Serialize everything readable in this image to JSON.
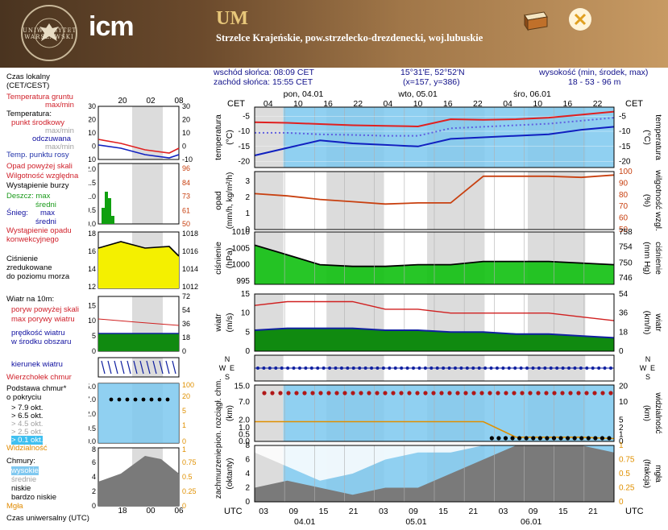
{
  "header": {
    "uw_logo_text": "UNIWERSYTET WARSZAWSKI",
    "icm_logo": "icm",
    "model": "UM",
    "location": "Strzelce Krajeńskie, pow.strzelecko-drezdenecki, woj.lubuskie",
    "archive_icon": "archive-box-icon",
    "close_icon": "close-x-icon"
  },
  "info": {
    "sunrise": "wschód słońca: 08:09 CET",
    "sunset": "zachód słońca: 15:55 CET",
    "coords": "15°31'E, 52°52'N",
    "grid": "(x=157, y=386)",
    "elev_label": "wysokość (min, środek, max)",
    "elev_values": "18 - 53 - 96 m"
  },
  "legend": {
    "local_time": "Czas lokalny",
    "local_time2": "(CET/CEST)",
    "soil_temp": "Temperatura gruntu",
    "soil_temp2": "max/min",
    "temperature": "Temperatura:",
    "center_point": "punkt środkowy",
    "maxmin": "max/min",
    "perceived": "odczuwana",
    "dew_point": "Temp. punktu rosy",
    "precip_over": "Opad powyżej skali",
    "humidity": "Wilgotność względna",
    "storm": "Wystąpienie burzy",
    "rain": "Deszcz: max",
    "rain_avg": "średni",
    "snow": "Śnieg:",
    "snow_max": "max",
    "snow_avg": "średni",
    "convective": "Wystąpienie opadu",
    "convective2": "konwekcyjnego",
    "pressure": "Ciśnienie",
    "pressure2": "zredukowane",
    "pressure3": "do poziomu morza",
    "wind_at": "Wiatr na 10m:",
    "gust_over": "poryw powyżej skali",
    "gust_max": "max porywy wiatru",
    "wind_speed": "prędkość wiatru",
    "wind_area": "w środku obszaru",
    "wind_dir": "kierunek wiatru",
    "cloud_top": "Wierzchołek chmur",
    "cloud_base": "Podstawa chmur*",
    "cloud_base2": "o pokryciu",
    "okt79": "> 7.9 okt.",
    "okt65": "> 6.5 okt.",
    "okt45": "> 4.5 okt.",
    "okt25": "> 2.5 okt.",
    "okt01": "> 0.1 okt.",
    "visibility": "Widzialność",
    "clouds": "Chmury:",
    "high": "wysokie",
    "medium": "średnie",
    "low": "niskie",
    "very_low": "bardzo niskie",
    "fog": "Mgła",
    "utc_time": "Czas uniwersalny (UTC)"
  },
  "axes": {
    "cet": "CET",
    "utc": "UTC",
    "day1": "pon, 04.01",
    "day2": "wto, 05.01",
    "day3": "śro, 06.01",
    "day1_utc": "04.01",
    "day2_utc": "05.01",
    "day3_utc": "06.01",
    "temp_label": "temperatura",
    "temp_unit": "(°C)",
    "precip_label": "opad",
    "precip_unit": "(mm/h, kg/m²/h)",
    "hum_label": "wilgotność wzgl.",
    "hum_unit": "(%)",
    "press_label": "ciśnienie",
    "press_unit": "(hPa)",
    "press_unit_r": "(mm Hg)",
    "wind_label": "wiatr",
    "wind_unit": "(m/s)",
    "wind_unit_r": "(km/h)",
    "cloud_label": "pion. rozciągł. chm.",
    "cloud_unit": "(km)",
    "vis_label": "widzialność",
    "vis_unit": "(km)",
    "cover_label": "zachmurzenie",
    "cover_unit": "(oktanty)",
    "fog_label": "mgła",
    "fog_unit": "(frakcja)",
    "compass": {
      "n": "N",
      "w": "W",
      "s": "S",
      "e": "E"
    }
  },
  "colors": {
    "temp": "#e02020",
    "perceived": "#1020c0",
    "dew": "#6060e0",
    "humidity": "#c84010",
    "pressure": "#10c010",
    "wind": "#107010",
    "gust": "#d02020",
    "visibility": "#e09000"
  },
  "chart_data": [
    {
      "type": "line",
      "title": "",
      "ylabel": "temperatura (°C)",
      "ylim": [
        -22,
        -2
      ],
      "x_cet": [
        "04",
        "10",
        "16",
        "22",
        "04",
        "10",
        "16",
        "22",
        "04",
        "10",
        "16",
        "22"
      ],
      "series": [
        {
          "name": "punkt środkowy",
          "values": [
            -7.0,
            -7.2,
            -7.6,
            -8.0,
            -8.2,
            -8.4,
            -6.0,
            -6.2,
            -6.0,
            -5.5,
            -4.5,
            -3.5
          ]
        },
        {
          "name": "odczuwana",
          "values": [
            -18.0,
            -15.5,
            -13.0,
            -14.0,
            -14.5,
            -15.0,
            -12.5,
            -12.0,
            -11.5,
            -11.0,
            -9.5,
            -8.5
          ]
        },
        {
          "name": "Temp. punktu rosy",
          "values": [
            -10.5,
            -10.5,
            -11.0,
            -11.2,
            -11.5,
            -11.5,
            -9.0,
            -8.5,
            -8.0,
            -7.5,
            -6.5,
            -5.5
          ]
        }
      ]
    },
    {
      "type": "line",
      "ylabel": "wilgotność wzgl. (%)",
      "ylim": [
        50,
        100
      ],
      "series": [
        {
          "name": "wilgotność",
          "values": [
            81,
            79,
            76,
            74,
            72,
            73,
            73,
            96,
            96,
            96,
            95,
            97
          ]
        }
      ]
    },
    {
      "type": "area",
      "ylabel": "ciśnienie (hPa)",
      "ylim": [
        994,
        1010
      ],
      "series": [
        {
          "name": "ciśnienie",
          "values": [
            1006,
            1003,
            1000,
            999.5,
            999.5,
            1000,
            1000,
            1001,
            1001,
            1001,
            1000.5,
            1000
          ]
        }
      ]
    },
    {
      "type": "area",
      "ylabel": "wiatr (m/s)",
      "ylim": [
        0,
        15
      ],
      "series": [
        {
          "name": "max porywy wiatru",
          "values": [
            12,
            13,
            13,
            13,
            11,
            11,
            10,
            10,
            10,
            10,
            9,
            8
          ]
        },
        {
          "name": "prędkość wiatru",
          "values": [
            5.5,
            6,
            6,
            6,
            5.5,
            5.5,
            5,
            5,
            4.5,
            4.5,
            4,
            3.5
          ]
        }
      ]
    },
    {
      "type": "line",
      "ylabel": "widzialność (km)",
      "ylim": [
        0,
        20
      ],
      "series": [
        {
          "name": "widzialność",
          "values": [
            7,
            7,
            7,
            7,
            7,
            7,
            7,
            7,
            1.5,
            1.5,
            1.5,
            1.0
          ]
        }
      ]
    },
    {
      "type": "area",
      "ylabel": "zachmurzenie (oktanty)",
      "ylim": [
        0,
        8
      ],
      "series": [
        {
          "name": "niskie",
          "values": [
            2,
            3,
            2,
            1,
            2,
            2,
            4,
            6,
            8,
            8,
            8,
            7
          ]
        },
        {
          "name": "wysokie",
          "values": [
            1,
            3,
            5,
            4,
            2,
            1,
            1,
            0,
            0,
            0,
            0,
            0
          ]
        }
      ]
    }
  ]
}
